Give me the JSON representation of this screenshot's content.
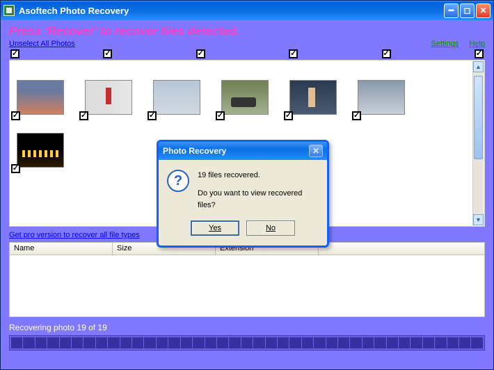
{
  "window": {
    "title": "Asoftech Photo Recovery"
  },
  "instruction": "Press 'Recover' to recover files detected.",
  "links": {
    "unselect": "Unselect All Photos",
    "settings": "Settings",
    "help": "Help",
    "pro": "Get pro version to recover all file types"
  },
  "table": {
    "headers": {
      "name": "Name",
      "size": "Size",
      "ext": "Extension"
    }
  },
  "status": "Recovering photo 19 of 19",
  "dialog": {
    "title": "Photo Recovery",
    "line1": "19 files recovered.",
    "line2": "Do you want to view recovered files?",
    "yes": "Yes",
    "no": "No"
  },
  "thumbs": {
    "row1": [
      {
        "name": "crowd"
      },
      {
        "name": "runner"
      },
      {
        "name": "race"
      },
      {
        "name": "car"
      },
      {
        "name": "sprint"
      },
      {
        "name": "watch"
      }
    ],
    "row2": [
      {
        "name": "night"
      }
    ]
  }
}
